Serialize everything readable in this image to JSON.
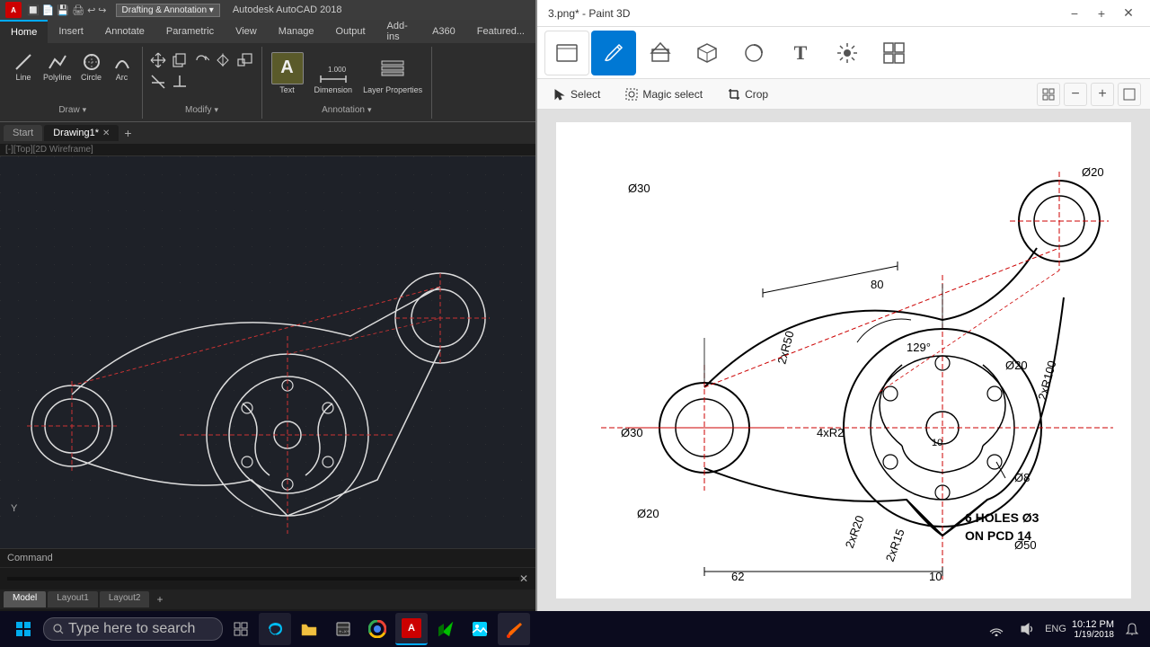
{
  "autocad": {
    "title": "Autodesk AutoCAD 2018",
    "workspace": "Drafting & Annotation",
    "tabs": {
      "home": "Home",
      "insert": "Insert",
      "annotate": "Annotate",
      "parametric": "Parametric",
      "view": "View",
      "manage": "Manage",
      "output": "Output",
      "addins": "Add-ins",
      "a360": "A360",
      "featured": "Featured..."
    },
    "active_tab": "Home",
    "draw_group": "Draw",
    "modify_group": "Modify",
    "annotation_group": "Annotation",
    "tools": {
      "line": "Line",
      "polyline": "Polyline",
      "circle": "Circle",
      "arc": "Arc",
      "text": "Text",
      "dimension": "Dimension",
      "layer_properties": "Layer Properties"
    },
    "doc_tabs": [
      {
        "label": "Start",
        "active": false
      },
      {
        "label": "Drawing1*",
        "active": true,
        "closeable": true
      }
    ],
    "viewport_label": "[-][Top][2D Wireframe]",
    "model_tabs": [
      "Model",
      "Layout1",
      "Layout2"
    ],
    "active_model_tab": "Model"
  },
  "paint3d": {
    "title": "3.png* - Paint 3D",
    "toolbar_items": [
      {
        "id": "canvas",
        "label": "",
        "icon": "⬜"
      },
      {
        "id": "brushes",
        "label": "",
        "icon": "✏️",
        "active": true
      },
      {
        "id": "shapes2d",
        "label": "",
        "icon": "🔷"
      },
      {
        "id": "shapes3d",
        "label": "",
        "icon": "🔶"
      },
      {
        "id": "stickers",
        "label": "",
        "icon": "⊘"
      },
      {
        "id": "text",
        "label": "",
        "icon": "T"
      },
      {
        "id": "effects",
        "label": "",
        "icon": "✳"
      },
      {
        "id": "canvas2",
        "label": "",
        "icon": "⊞"
      }
    ],
    "secondary_toolbar": {
      "select": "Select",
      "magic_select": "Magic select",
      "crop": "Crop"
    },
    "window_controls": {
      "minimize": "−",
      "maximize": "+",
      "close": "✕"
    }
  },
  "drawing": {
    "annotations": [
      "Ø30",
      "Ø20",
      "80",
      "129°",
      "2xR50",
      "2xR100",
      "Ø30",
      "Ø20",
      "4xR2",
      "10",
      "Ø8",
      "Ø20",
      "2xR20",
      "2xR15",
      "Ø50",
      "6 HOLES Ø3",
      "ON PCD 14",
      "62",
      "10"
    ]
  },
  "taskbar": {
    "search_placeholder": "Type here to search",
    "time": "10:12 PM",
    "date": "1/19/2018",
    "language": "ENG"
  }
}
